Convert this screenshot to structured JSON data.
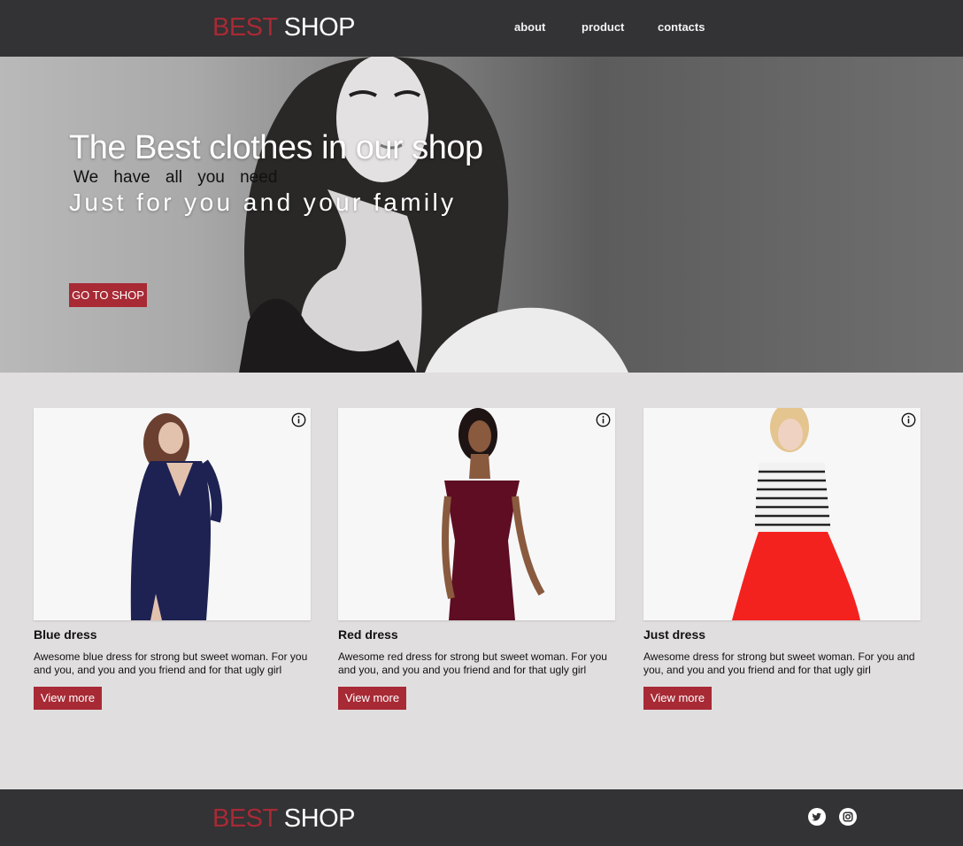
{
  "brand": {
    "part1": "BEST",
    "part2": "SHOP"
  },
  "nav": {
    "about": "about",
    "product": "product",
    "contacts": "contacts"
  },
  "hero": {
    "title": "The Best clothes in our shop",
    "subtitle": "We have all you need",
    "tagline": "Just for you and your family",
    "cta": "GO TO SHOP"
  },
  "products": [
    {
      "name": "Blue dress",
      "description": "Awesome blue dress for strong but sweet woman. For you and you, and you and you friend and for that ugly girl",
      "button": "View more"
    },
    {
      "name": "Red dress",
      "description": "Awesome red dress for strong but sweet woman. For you and you, and you and you friend and for that ugly girl",
      "button": "View more"
    },
    {
      "name": "Just dress",
      "description": "Awesome dress for strong but sweet woman. For you and you, and you and you friend and for that ugly girl",
      "button": "View more"
    }
  ],
  "footer": {
    "brand_part1": "BEST",
    "brand_part2": "SHOP",
    "social": [
      "twitter-icon",
      "instagram-icon"
    ]
  },
  "colors": {
    "accent": "#a72a35",
    "header_bg": "#333234",
    "page_bg": "#e0dedf"
  }
}
